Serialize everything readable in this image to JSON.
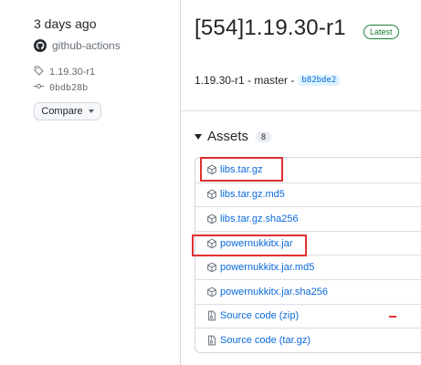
{
  "sidebar": {
    "date": "3 days ago",
    "actor": "github-actions",
    "tag": "1.19.30-r1",
    "commit": "0bdb28b",
    "compare_label": "Compare"
  },
  "release": {
    "title": "[554]1.19.30-r1",
    "badge": "Latest",
    "subline": "1.19.30-r1 - master -",
    "commit_hash": "b82bde2"
  },
  "assets": {
    "heading": "Assets",
    "count": "8",
    "items": [
      {
        "name": "libs.tar.gz",
        "suffix": ""
      },
      {
        "name": "libs.tar.gz.md5",
        "suffix": ""
      },
      {
        "name": "libs.tar.gz.sha256",
        "suffix": ""
      },
      {
        "name": "powernukkitx.jar",
        "suffix": ""
      },
      {
        "name": "powernukkitx.jar.md5",
        "suffix": ""
      },
      {
        "name": "powernukkitx.jar.sha256",
        "suffix": ""
      },
      {
        "name": "Source code",
        "suffix": " (zip)"
      },
      {
        "name": "Source code",
        "suffix": " (tar.gz)"
      }
    ]
  },
  "colors": {
    "link": "#0969da",
    "latest_green": "#1a7f37",
    "highlight_red": "#e03131"
  }
}
